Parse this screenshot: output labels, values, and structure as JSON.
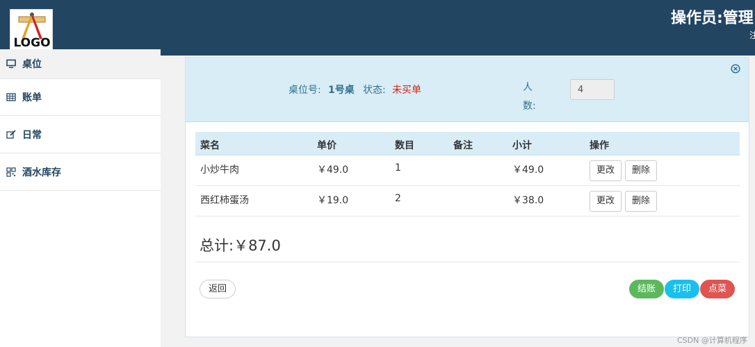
{
  "header": {
    "logo_text": "LOGO",
    "operator": "操作员:管理",
    "operator_sub": "注"
  },
  "sidebar": {
    "items": [
      {
        "label": "桌位",
        "icon": "monitor-icon"
      },
      {
        "label": "账单",
        "icon": "table-icon"
      },
      {
        "label": "日常",
        "icon": "edit-icon"
      },
      {
        "label": "酒水库存",
        "icon": "qrcode-icon"
      }
    ]
  },
  "order": {
    "table_label": "桌位号:",
    "table_value": "1号桌",
    "status_label": "状态:",
    "status_value": "未买单",
    "people_label": "人数:",
    "people_value": "4"
  },
  "table": {
    "headers": [
      "菜名",
      "单价",
      "数目",
      "备注",
      "小计",
      "操作"
    ],
    "rows": [
      {
        "name": "小炒牛肉",
        "price": "￥49.0",
        "qty": "1",
        "note": "",
        "subtotal": "￥49.0"
      },
      {
        "name": "西红柿蛋汤",
        "price": "￥19.0",
        "qty": "2",
        "note": "",
        "subtotal": "￥38.0"
      }
    ],
    "edit_label": "更改",
    "delete_label": "删除"
  },
  "total": "总计:￥87.0",
  "buttons": {
    "back": "返回",
    "checkout": "结账",
    "print": "打印",
    "order": "点菜"
  },
  "colors": {
    "header_bg": "#224562",
    "panel_head_bg": "#d9edf7",
    "status_red": "#d9230f",
    "success": "#5cb85c",
    "info": "#19c0ee",
    "danger": "#e05452"
  },
  "watermark": "CSDN @计算机程序"
}
